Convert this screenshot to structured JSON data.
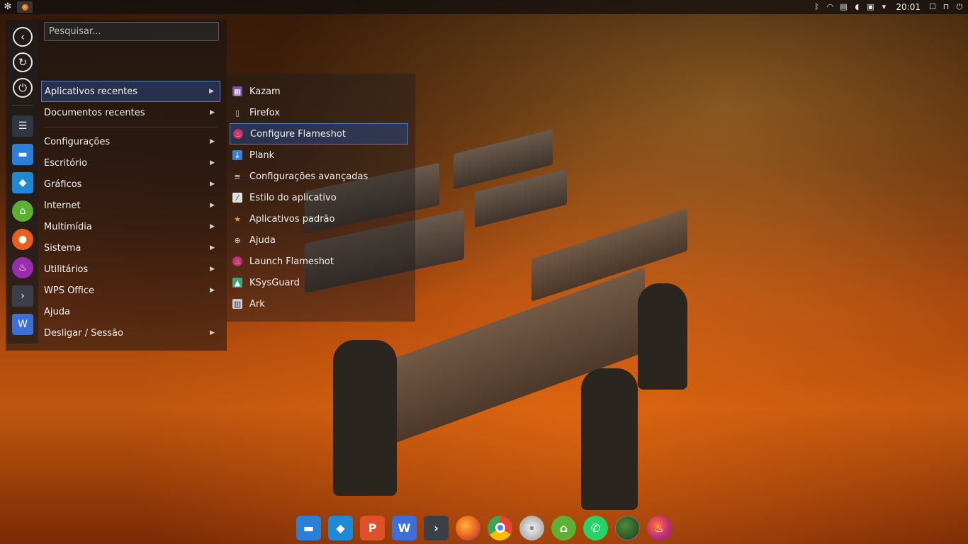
{
  "top_panel": {
    "launcher_icon": "kde-logo-icon",
    "task_icon": "flameshot-icon",
    "tray_icons": [
      "bluetooth-icon",
      "wifi-icon",
      "clipboard-icon",
      "volume-icon",
      "display-icon",
      "notifications-arrow-icon"
    ],
    "clock": "20:01",
    "right_icons": [
      "maximize-icon",
      "lock-icon",
      "power-icon"
    ]
  },
  "menu": {
    "search_placeholder": "Pesquisar...",
    "rail_buttons": [
      "back-icon",
      "restart-icon",
      "power-icon"
    ],
    "rail_apps": [
      "settings-sliders-icon",
      "folder-icon",
      "app-store-icon",
      "network-drive-icon",
      "firefox-icon",
      "flameshot-icon",
      "terminal-icon",
      "wps-writer-icon"
    ],
    "categories": [
      {
        "label": "Aplicativos recentes",
        "has_arrow": true,
        "active": true
      },
      {
        "label": "Documentos recentes",
        "has_arrow": true,
        "active": false
      },
      {
        "label": "Configurações",
        "has_arrow": true,
        "active": false
      },
      {
        "label": "Escritório",
        "has_arrow": true,
        "active": false
      },
      {
        "label": "Gráficos",
        "has_arrow": true,
        "active": false
      },
      {
        "label": "Internet",
        "has_arrow": true,
        "active": false
      },
      {
        "label": "Multimídia",
        "has_arrow": true,
        "active": false
      },
      {
        "label": "Sistema",
        "has_arrow": true,
        "active": false
      },
      {
        "label": "Utilitários",
        "has_arrow": true,
        "active": false
      },
      {
        "label": "WPS Office",
        "has_arrow": true,
        "active": false
      },
      {
        "label": "Ajuda",
        "has_arrow": false,
        "active": false
      },
      {
        "label": "Desligar / Sessão",
        "has_arrow": true,
        "active": false
      }
    ],
    "recent_apps": [
      {
        "label": "Kazam",
        "icon": "kazam-icon",
        "color": "#7b4fa8",
        "active": false
      },
      {
        "label": "Firefox",
        "icon": "document-icon",
        "color": "#cccccc",
        "active": false
      },
      {
        "label": "Configure Flameshot",
        "icon": "flameshot-icon",
        "color": "#c42d7a",
        "active": true
      },
      {
        "label": "Plank",
        "icon": "plank-icon",
        "color": "#3a7fd4",
        "active": false
      },
      {
        "label": "Configurações avançadas",
        "icon": "menu-lines-icon",
        "color": "#e8e8e8",
        "active": false
      },
      {
        "label": "Estilo do aplicativo",
        "icon": "brush-icon",
        "color": "#e0e0e0",
        "active": false
      },
      {
        "label": "Aplicativos padrão",
        "icon": "star-icon",
        "color": "#f0a020",
        "active": false
      },
      {
        "label": "Ajuda",
        "icon": "lifebuoy-icon",
        "color": "#d8d8d8",
        "active": false
      },
      {
        "label": "Launch Flameshot",
        "icon": "flameshot-icon",
        "color": "#c42d7a",
        "active": false
      },
      {
        "label": "KSysGuard",
        "icon": "ksysguard-icon",
        "color": "#3aa878",
        "active": false
      },
      {
        "label": "Ark",
        "icon": "ark-icon",
        "color": "#c8c8d8",
        "active": false
      }
    ]
  },
  "dock": {
    "items": [
      {
        "name": "files-icon",
        "color": "#2a7fd8",
        "glyph": ""
      },
      {
        "name": "app-store-icon",
        "color": "#1e8ad6",
        "glyph": ""
      },
      {
        "name": "wps-presentation-icon",
        "color": "#e0502a",
        "glyph": "P"
      },
      {
        "name": "wps-writer-icon",
        "color": "#3d6fd6",
        "glyph": "W"
      },
      {
        "name": "terminal-icon",
        "color": "#3b4046",
        "glyph": ">"
      },
      {
        "name": "firefox-icon",
        "color": "#e8601c",
        "glyph": ""
      },
      {
        "name": "chrome-icon",
        "color": "#34a853",
        "glyph": ""
      },
      {
        "name": "disc-icon",
        "color": "#bfbfbf",
        "glyph": ""
      },
      {
        "name": "network-drive-icon",
        "color": "#5cb032",
        "glyph": ""
      },
      {
        "name": "whatsapp-icon",
        "color": "#25d366",
        "glyph": ""
      },
      {
        "name": "globe-icon",
        "color": "#2c5a2a",
        "glyph": ""
      },
      {
        "name": "flameshot-icon",
        "color": "#9a2cb0",
        "glyph": ""
      }
    ]
  }
}
